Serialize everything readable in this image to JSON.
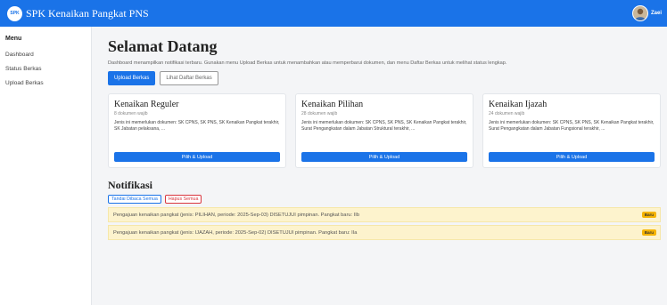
{
  "header": {
    "logo_text": "SPK",
    "app_title": "SPK Kenaikan Pangkat PNS",
    "user_name": "Zaei"
  },
  "sidebar": {
    "title": "Menu",
    "items": [
      {
        "label": "Dashboard"
      },
      {
        "label": "Status Berkas"
      },
      {
        "label": "Upload Berkas"
      }
    ]
  },
  "main": {
    "title": "Selamat Datang",
    "description": "Dashboard menampilkan notifikasi terbaru. Gunakan menu Upload Berkas untuk menambahkan atau memperbarui dokumen, dan menu Daftar Berkas untuk melihat status lengkap.",
    "primary_button": "Upload Berkas",
    "secondary_button": "Lihat Daftar Berkas"
  },
  "cards": [
    {
      "title": "Kenaikan Reguler",
      "subtitle": "8 dokumen wajib",
      "body": "Jenis ini memerlukan dokumen: SK CPNS, SK PNS, SK Kenaikan Pangkat terakhir, SK Jabatan pelaksana, ...",
      "button": "Pilih & Upload"
    },
    {
      "title": "Kenaikan Pilihan",
      "subtitle": "28 dokumen wajib",
      "body": "Jenis ini memerlukan dokumen: SK CPNS, SK PNS, SK Kenaikan Pangkat terakhir, Surat Pengangkatan dalam Jabatan Struktural terakhir, ...",
      "button": "Pilih & Upload"
    },
    {
      "title": "Kenaikan Ijazah",
      "subtitle": "24 dokumen wajib",
      "body": "Jenis ini memerlukan dokumen: SK CPNS, SK PNS, SK Kenaikan Pangkat terakhir, Surat Pengangkatan dalam Jabatan Fungsional terakhir, ...",
      "button": "Pilih & Upload"
    }
  ],
  "notifications": {
    "title": "Notifikasi",
    "mark_read_button": "Tandai Dibaca Semua",
    "delete_all_button": "Hapus Semua",
    "items": [
      {
        "text": "Pengajuan kenaikan pangkat (jenis: PILIHAN, periode: 2025-Sep-03) DISETUJUI pimpinan. Pangkat baru: IIb",
        "badge": "Baru"
      },
      {
        "text": "Pengajuan kenaikan pangkat (jenis: IJAZAH, periode: 2025-Sep-02) DISETUJUI pimpinan. Pangkat baru: IIa",
        "badge": "Baru"
      }
    ]
  },
  "colors": {
    "primary": "#1a73e8",
    "danger": "#d9363e",
    "notification_bg": "#fdf3cd",
    "badge": "#f5b301"
  }
}
